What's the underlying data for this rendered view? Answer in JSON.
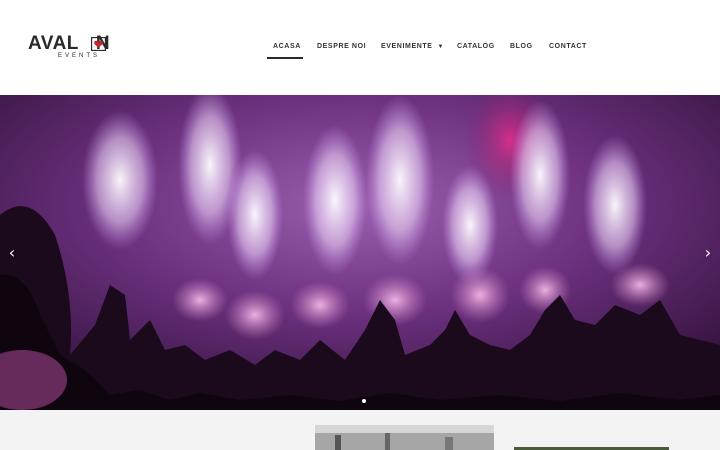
{
  "brand": {
    "name_part1": "AVAL",
    "name_part2": "N",
    "subtitle": "EVENTS",
    "accent_color": "#c0262d"
  },
  "nav": {
    "items": [
      {
        "label": "ACASA",
        "active": true
      },
      {
        "label": "DESPRE NOI",
        "active": false
      },
      {
        "label": "EVENIMENTE",
        "active": false,
        "has_dropdown": true
      },
      {
        "label": "CATALOG",
        "active": false
      },
      {
        "label": "BLOG",
        "active": false
      },
      {
        "label": "CONTACT",
        "active": false
      }
    ]
  },
  "slider": {
    "prev_icon": "chevron-left-icon",
    "next_icon": "chevron-right-icon",
    "prev_glyph": "‹",
    "next_glyph": "›",
    "slide_count": 2,
    "active_slide": 1,
    "image_subject": "concert-crowd-fireworks"
  },
  "colors": {
    "hero_purple": "#6b2a7a",
    "nav_text": "#333333"
  }
}
